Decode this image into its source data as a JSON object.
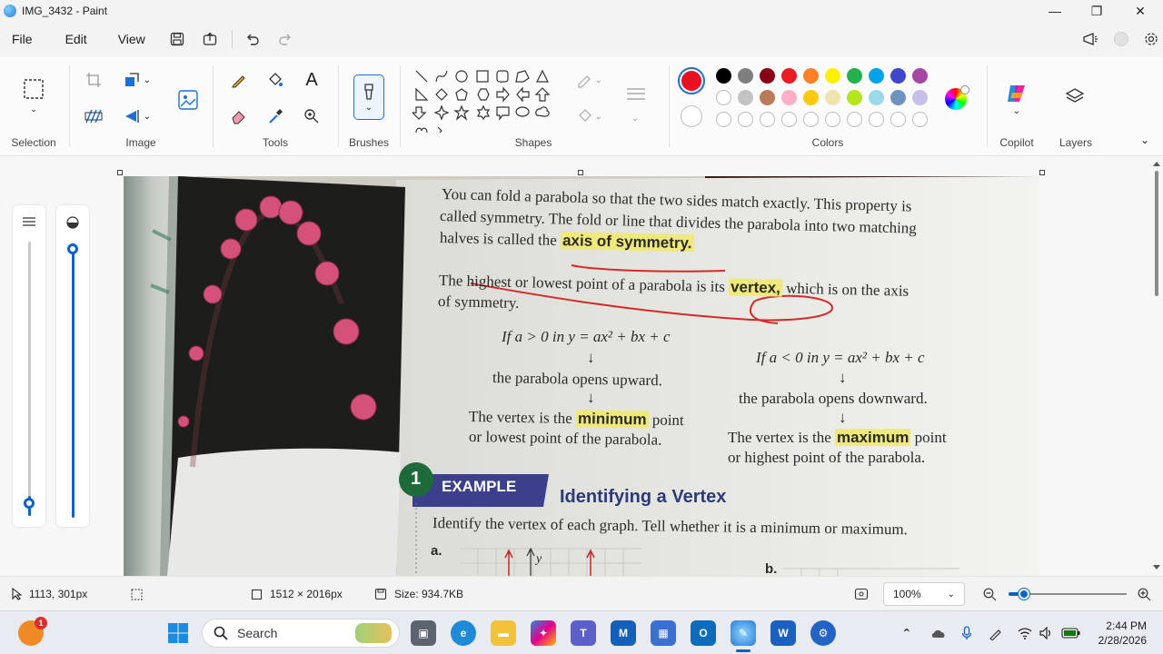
{
  "window": {
    "title": "IMG_3432 - Paint",
    "minimize": "—",
    "maximize": "❐",
    "close": "✕"
  },
  "menu": {
    "file": "File",
    "edit": "Edit",
    "view": "View"
  },
  "ribbon": {
    "groups": {
      "selection": "Selection",
      "image": "Image",
      "tools": "Tools",
      "brushes": "Brushes",
      "shapes": "Shapes",
      "colors": "Colors",
      "copilot": "Copilot",
      "layers": "Layers"
    },
    "colors": {
      "primary": "#e81123",
      "secondary": "#ffffff",
      "palette_row1": [
        "#000000",
        "#7f7f7f",
        "#880015",
        "#ed1c24",
        "#ff7f27",
        "#fff200",
        "#22b14c",
        "#00a2e8",
        "#3f48cc",
        "#a349a4"
      ],
      "palette_row2": [
        "#ffffff",
        "#c3c3c3",
        "#b97a57",
        "#ffaec9",
        "#ffc90e",
        "#efe4b0",
        "#b5e61d",
        "#99d9ea",
        "#7092be",
        "#c8bfe7"
      ]
    }
  },
  "document": {
    "lines": {
      "l1": "You can fold a parabola so that the two sides match exactly. This property is",
      "l2": "called symmetry. The fold or line that divides the parabola into two matching",
      "l3a": "halves is called the",
      "l3b": "axis of symmetry.",
      "l4a": "The highest or lowest point of a parabola is its",
      "l4b": "vertex,",
      "l4c": "which is on the axis",
      "l5": "of symmetry.",
      "cond_left": "If a > 0 in y = ax² + bx + c",
      "cond_right": "If a < 0 in y = ax² + bx + c",
      "arrow": "↓",
      "opens_up": "the parabola opens upward.",
      "opens_down": "the parabola opens downward.",
      "vertex_min_a": "The vertex is the",
      "vertex_min_b": "minimum",
      "vertex_min_c": "point",
      "vertex_min_2": "or lowest point of the parabola.",
      "vertex_max_a": "The vertex is the",
      "vertex_max_b": "maximum",
      "vertex_max_c": "point",
      "vertex_max_2": "or highest point of the parabola.",
      "example_num": "1",
      "example_label": "EXAMPLE",
      "example_title": "Identifying a Vertex",
      "instruction": "Identify the vertex of each graph. Tell whether it is a minimum or maximum.",
      "part_a": "a.",
      "part_b": "b.",
      "y_label": "y"
    }
  },
  "status": {
    "cursor_pos": "1113, 301px",
    "dimensions": "1512 × 2016px",
    "size": "Size: 934.7KB",
    "zoom": "100%",
    "zoom_fraction": 0.13
  },
  "taskbar": {
    "search_placeholder": "Search",
    "badge": "1",
    "time": "2:44 PM",
    "date": "2/28/2026"
  }
}
